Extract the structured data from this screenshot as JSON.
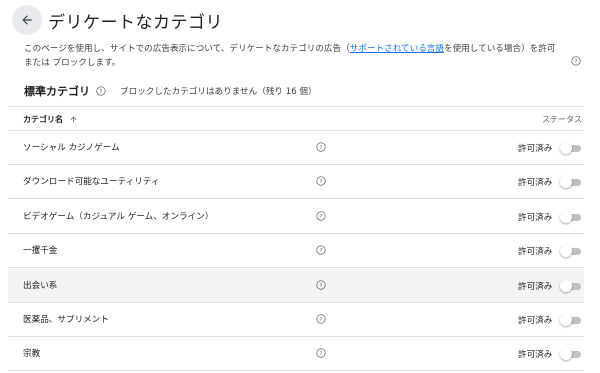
{
  "header": {
    "title": "デリケートなカテゴリ"
  },
  "description": {
    "text_before": "このページを使用し、サイトでの広告表示について、デリケートなカテゴリの広告（",
    "link": "サポートされている言語",
    "text_after": "を使用している場合）を許可または ブロックします。"
  },
  "section": {
    "title": "標準カテゴリ",
    "note": "ブロックしたカテゴリはありません（残り 16 個）"
  },
  "table": {
    "col_name": "カテゴリ名",
    "col_status": "ステータス",
    "rows": [
      {
        "name": "ソーシャル カジノゲーム",
        "status": "許可済み"
      },
      {
        "name": "ダウンロード可能なユーティリティ",
        "status": "許可済み"
      },
      {
        "name": "ビデオゲーム（カジュアル ゲーム、オンライン）",
        "status": "許可済み"
      },
      {
        "name": "一攫千金",
        "status": "許可済み"
      },
      {
        "name": "出会い系",
        "status": "許可済み"
      },
      {
        "name": "医薬品、サプリメント",
        "status": "許可済み"
      },
      {
        "name": "宗教",
        "status": "許可済み"
      }
    ]
  },
  "icons": {
    "back": "arrow-back-icon",
    "help": "help-circle-icon",
    "sort": "arrow-up-icon"
  },
  "colors": {
    "link": "#1a73e8",
    "toggle_track_off": "#bdc1c6",
    "row_highlight": "#f1f3f4"
  }
}
